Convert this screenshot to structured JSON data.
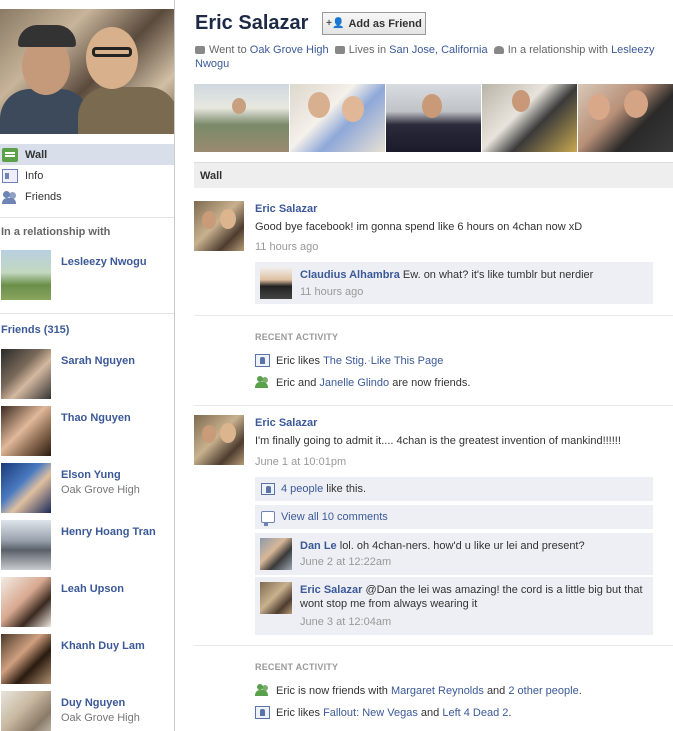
{
  "profile": {
    "name": "Eric Salazar",
    "add_friend_label": "Add as Friend",
    "bio": {
      "school_prefix": "Went to",
      "school": "Oak Grove High",
      "lives_prefix": "Lives in",
      "city": "San Jose, California",
      "relationship_prefix": "In a relationship with",
      "partner": "Lesleezy Nwogu"
    }
  },
  "nav": {
    "items": [
      {
        "label": "Wall",
        "icon": "wall-icon"
      },
      {
        "label": "Info",
        "icon": "info-icon"
      },
      {
        "label": "Friends",
        "icon": "friends-icon"
      }
    ]
  },
  "relationship": {
    "heading": "In a relationship with",
    "name": "Lesleezy Nwogu"
  },
  "friends": {
    "heading": "Friends (315)",
    "list": [
      {
        "name": "Sarah Nguyen",
        "sub": ""
      },
      {
        "name": "Thao Nguyen",
        "sub": ""
      },
      {
        "name": "Elson Yung",
        "sub": "Oak Grove High"
      },
      {
        "name": "Henry Hoang Tran",
        "sub": ""
      },
      {
        "name": "Leah Upson",
        "sub": ""
      },
      {
        "name": "Khanh Duy Lam",
        "sub": ""
      },
      {
        "name": "Duy Nguyen",
        "sub": "Oak Grove High"
      }
    ]
  },
  "wall_tab_label": "Wall",
  "posts": [
    {
      "author": "Eric Salazar",
      "text": "Good bye facebook! im gonna spend like 6 hours on 4chan now xD",
      "time": "11 hours ago",
      "comment": {
        "author": "Claudius Alhambra",
        "text": "Ew. on what? it's like tumblr but nerdier",
        "time": "11 hours ago"
      }
    },
    {
      "author": "Eric Salazar",
      "text": "I'm finally going to admit it.... 4chan is the greatest invention of mankind!!!!!!",
      "time": "June 1 at 10:01pm",
      "likes_link": "4 people",
      "likes_suffix": "like this.",
      "view_comments": "View all 10 comments",
      "comments": [
        {
          "author": "Dan Le",
          "text": "lol. oh 4chan-ners. how'd u like ur lei and present?",
          "time": "June 2 at 12:22am"
        },
        {
          "author": "Eric Salazar",
          "text": "@Dan the lei was amazing! the cord is a little big but that wont stop me from always wearing it",
          "time": "June 3 at 12:04am"
        }
      ]
    }
  ],
  "recent_activity_1": {
    "heading": "RECENT ACTIVITY",
    "line1": {
      "prefix": "Eric likes",
      "link": "The Stig.",
      "sep": " · ",
      "action": "Like This Page"
    },
    "line2": {
      "prefix": "Eric and",
      "link": "Janelle Glindo",
      "suffix": "are now friends."
    }
  },
  "recent_activity_2": {
    "heading": "RECENT ACTIVITY",
    "line1": {
      "prefix": "Eric is now friends with",
      "link1": "Margaret Reynolds",
      "mid": "and",
      "link2": "2 other people",
      "end": "."
    },
    "line2": {
      "prefix": "Eric likes",
      "link1": "Fallout: New Vegas",
      "mid": "and",
      "link2": "Left 4 Dead 2",
      "end": "."
    }
  }
}
